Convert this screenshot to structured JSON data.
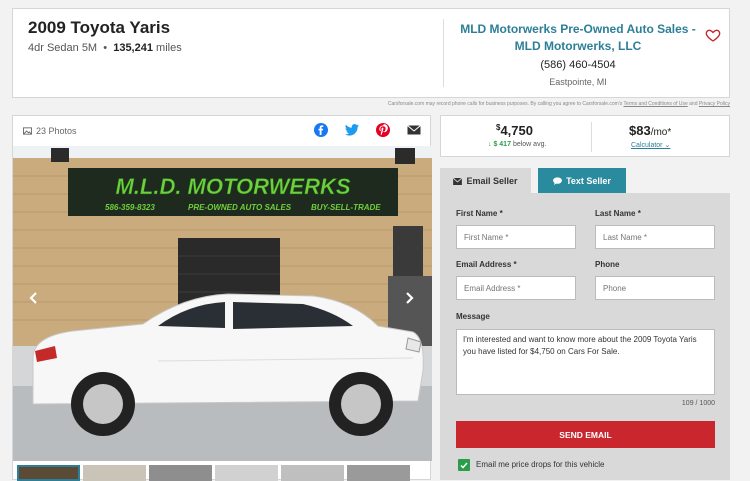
{
  "listing": {
    "title": "2009 Toyota Yaris",
    "trim": "4dr Sedan 5M",
    "mileage": "135,241",
    "mileage_unit": "miles"
  },
  "dealer": {
    "name": "MLD Motorwerks Pre-Owned Auto Sales - MLD Motorwerks, LLC",
    "phone": "(586) 460-4504",
    "location": "Eastpointe, MI"
  },
  "disclaimer": {
    "text": "Carsforsale.com may record phone calls for business purposes. By calling you agree to Carsforsale.com's",
    "terms_link": "Terms and Conditions of Use",
    "and": "and",
    "privacy_link": "Privacy Policy"
  },
  "gallery": {
    "photo_count": "23 Photos",
    "sign_text": "M.L.D. MOTORWERKS",
    "sign_phone": "586-359-8323",
    "sign_sub": "PRE-OWNED AUTO SALES",
    "sign_trade": "BUY-SELL-TRADE"
  },
  "price": {
    "currency": "$",
    "amount": "4,750",
    "below_amount": "$ 417",
    "below_text": "below avg.",
    "monthly": "$83",
    "monthly_unit": "/mo*",
    "calculator": "Calculator"
  },
  "tabs": {
    "email": "Email Seller",
    "text": "Text Seller"
  },
  "form": {
    "first_name_label": "First Name",
    "first_name_placeholder": "First Name *",
    "last_name_label": "Last Name",
    "last_name_placeholder": "Last Name *",
    "email_label": "Email Address",
    "email_placeholder": "Email Address *",
    "phone_label": "Phone",
    "phone_placeholder": "Phone",
    "message_label": "Message",
    "message_value": "I'm interested and want to know more about the 2009 Toyota Yaris you have listed for $4,750 on Cars For Sale.",
    "char_count": "109 / 1000",
    "send_label": "SEND EMAIL",
    "checkbox_label": "Email me price drops for this vehicle",
    "required_mark": "*"
  },
  "colors": {
    "accent": "#2d7f97",
    "send": "#c9262e",
    "check": "#2a9d4a"
  }
}
